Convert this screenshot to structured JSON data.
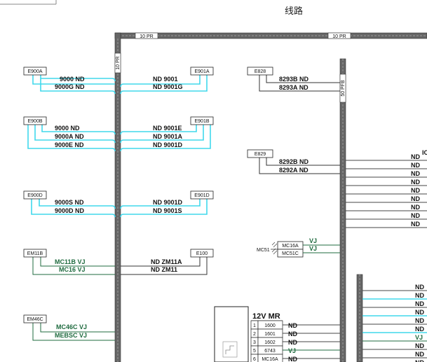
{
  "header": {
    "title": "线路"
  },
  "trunks": {
    "top_left": "10 PR",
    "top_right": "10 PR",
    "vertical_left": "10 PR",
    "vertical_right": "50 PFB"
  },
  "boxes": {
    "e900a": "E900A",
    "e901a": "E901A",
    "e900b": "E900B",
    "e901b": "E901B",
    "e900d": "E900D",
    "e901d": "E901D",
    "em11b": "EM11B",
    "e100": "E100",
    "em46c": "EM46C",
    "e828": "E828",
    "e829": "E829"
  },
  "wires": {
    "a_l1": "9000 ND",
    "a_l2": "9000G ND",
    "a_r1": "ND 9001",
    "a_r2": "ND 9001G",
    "b_l1": "9000 ND",
    "b_l2": "9000A ND",
    "b_l3": "9000E ND",
    "b_r1": "ND 9001E",
    "b_r2": "ND 9001A",
    "b_r3": "ND 9001D",
    "d_l1": "9000S ND",
    "d_l2": "9000D ND",
    "d_r1": "ND 9001D",
    "d_r2": "ND 9001S",
    "em11b_1": "MC11B VJ",
    "em11b_2": "MC16 VJ",
    "e100_1": "ND ZM11A",
    "e100_2": "ND ZM11",
    "em46c_1": "MC46C VJ",
    "em46c_2": "MEBSC VJ",
    "e828_1": "8293B ND",
    "e828_2": "8293A ND",
    "e829_1": "8292B ND",
    "e829_2": "8292A ND"
  },
  "mc51": {
    "label": "MC51",
    "relays": [
      "MC16A",
      "MC51C"
    ],
    "vj": [
      "VJ",
      "VJ"
    ]
  },
  "right_column_1": {
    "top_text": "IC",
    "labels": [
      "ND",
      "ND",
      "ND",
      "ND",
      "ND",
      "ND",
      "ND",
      "ND",
      "ND"
    ]
  },
  "right_column_2": {
    "labels": [
      "ND",
      "ND",
      "ND",
      "ND",
      "ND",
      "ND",
      "VJ",
      "ND",
      "ND",
      "ND"
    ]
  },
  "terminal_12v": {
    "title": "12V MR",
    "rows": [
      {
        "num": "1",
        "wire": "1600",
        "tag": "ND"
      },
      {
        "num": "2",
        "wire": "1601",
        "tag": "ND"
      },
      {
        "num": "3",
        "wire": "1602",
        "tag": "ND"
      },
      {
        "num": "5",
        "wire": "6743",
        "tag": "VJ"
      },
      {
        "num": "6",
        "wire": "MC16A",
        "tag": "ND"
      }
    ]
  },
  "colors": {
    "cyan_wire": "#40d8ec",
    "green_wire": "#1f6b3f",
    "black_wire": "#333333",
    "trunk_gray": "#555555"
  }
}
